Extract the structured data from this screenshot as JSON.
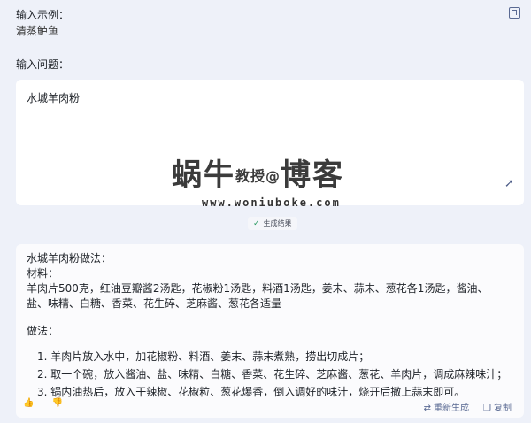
{
  "example": {
    "label": "输入示例：",
    "value": "清蒸鲈鱼"
  },
  "question": {
    "label": "输入问题：",
    "value": "水城羊肉粉"
  },
  "generate_button": {
    "icon": "check-icon",
    "label": "生成结果"
  },
  "watermark": {
    "logo_main": "蜗牛",
    "logo_small": "教授",
    "logo_right": "博客",
    "url": "www.woniuboke.com"
  },
  "result": {
    "title": "水城羊肉粉做法：",
    "materials_label": "材料：",
    "materials": "羊肉片500克，红油豆瓣酱2汤匙，花椒粉1汤匙，料酒1汤匙，姜末、蒜末、葱花各1汤匙，酱油、盐、味精、白糖、香菜、花生碎、芝麻酱、葱花各适量",
    "method_label": "做法：",
    "steps": [
      "1. 羊肉片放入水中，加花椒粉、料酒、姜末、蒜末煮熟，捞出切成片；",
      "2. 取一个碗，放入酱油、盐、味精、白糖、香菜、花生碎、芝麻酱、葱花、羊肉片，调成麻辣味汁；",
      "3. 锅内油热后，放入干辣椒、花椒粒、葱花爆香，倒入调好的味汁，烧开后撒上蒜末即可。"
    ]
  },
  "footer": {
    "regenerate_label": "重新生成",
    "copy_label": "复制"
  },
  "icons": {
    "expand": "expand-icon",
    "resize": "resize-arrow-icon",
    "like": "thumbs-up-icon",
    "dislike": "thumbs-down-icon",
    "regenerate": "refresh-icon",
    "copy": "copy-icon"
  }
}
